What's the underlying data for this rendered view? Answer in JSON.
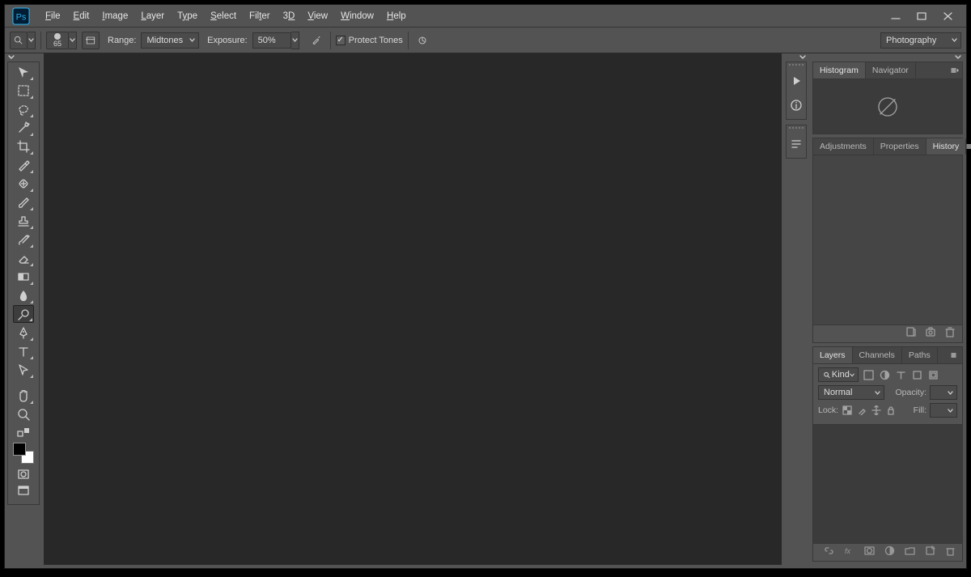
{
  "menu": {
    "file": "File",
    "edit": "Edit",
    "image": "Image",
    "layer": "Layer",
    "type": "Type",
    "select": "Select",
    "filter": "Filter",
    "threeD": "3D",
    "view": "View",
    "window": "Window",
    "help": "Help"
  },
  "options": {
    "brush_size": "65",
    "range_label": "Range:",
    "range_value": "Midtones",
    "exposure_label": "Exposure:",
    "exposure_value": "50%",
    "protect_tones": "Protect Tones",
    "workspace": "Photography"
  },
  "panels": {
    "histogram": {
      "tabs": [
        "Histogram",
        "Navigator"
      ],
      "active": 0
    },
    "adjustments": {
      "tabs": [
        "Adjustments",
        "Properties",
        "History"
      ],
      "active": 2
    },
    "layers": {
      "tabs": [
        "Layers",
        "Channels",
        "Paths"
      ],
      "active": 0,
      "kind": "Kind",
      "blend": "Normal",
      "opacity_label": "Opacity:",
      "lock_label": "Lock:",
      "fill_label": "Fill:"
    }
  }
}
